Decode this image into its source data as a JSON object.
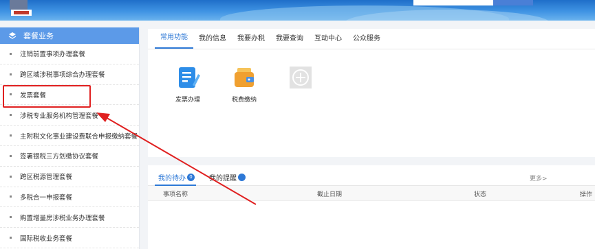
{
  "sidebar": {
    "title": "套餐业务",
    "items": [
      {
        "label": "注销前置事项办理套餐"
      },
      {
        "label": "跨区域涉税事项综合办理套餐"
      },
      {
        "label": "发票套餐"
      },
      {
        "label": "涉税专业服务机构管理套餐"
      },
      {
        "label": "主附税文化事业建设费联合申报缴纳套餐"
      },
      {
        "label": "签署银税三方划缴协议套餐"
      },
      {
        "label": "跨区税源管理套餐"
      },
      {
        "label": "多税合一申报套餐"
      },
      {
        "label": "购置增量房涉税业务办理套餐"
      },
      {
        "label": "国际税收业务套餐"
      }
    ]
  },
  "tabs": [
    {
      "label": "常用功能"
    },
    {
      "label": "我的信息"
    },
    {
      "label": "我要办税"
    },
    {
      "label": "我要查询"
    },
    {
      "label": "互动中心"
    },
    {
      "label": "公众服务"
    }
  ],
  "functions": [
    {
      "label": "发票办理",
      "icon": "invoice-edit-icon",
      "color": "#2d8de8"
    },
    {
      "label": "税费缴纳",
      "icon": "wallet-icon",
      "color": "#f0a030"
    },
    {
      "label": "",
      "icon": "add-icon",
      "color": "#d8d8d8"
    }
  ],
  "todo": {
    "tab_todo": "我的待办",
    "todo_count": "0",
    "tab_remind": "我的提醒",
    "remind_count": "",
    "more": "更多>",
    "columns": [
      "事项名称",
      "截止日期",
      "状态",
      "操作"
    ]
  },
  "colors": {
    "accent": "#2d78d6",
    "highlight": "#e02020",
    "sidebar_header": "#5c9ae8"
  }
}
